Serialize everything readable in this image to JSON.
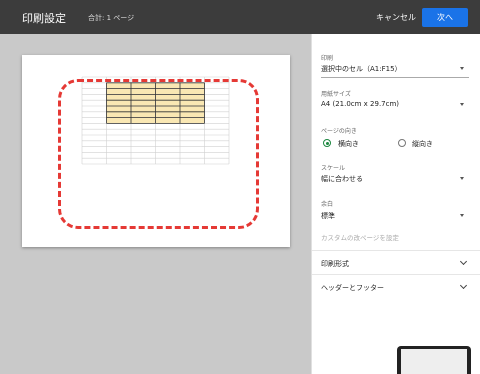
{
  "header": {
    "title": "印刷設定",
    "page_count": "合計: 1 ページ",
    "cancel_label": "キャンセル",
    "next_label": "次へ"
  },
  "colors": {
    "header_bg": "#3c3c3c",
    "accent": "#1a73e8",
    "selection_outline": "#e53935",
    "selected_cells": "#f9e7b3",
    "radio_on": "#1b873f"
  },
  "preview": {
    "sheet": {
      "rows": 15,
      "cols": 6,
      "highlight": {
        "rows": 7,
        "cols": 4
      }
    }
  },
  "settings": {
    "print_range": {
      "label": "印刷",
      "value": "選択中のセル（A1:F15）"
    },
    "paper_size": {
      "label": "用紙サイズ",
      "value": "A4 (21.0cm x 29.7cm)"
    },
    "orientation": {
      "label": "ページの向き",
      "landscape": "横向き",
      "portrait": "縦向き",
      "selected": "landscape"
    },
    "scale": {
      "label": "スケール",
      "value": "幅に合わせる"
    },
    "margins": {
      "label": "余白",
      "value": "標準"
    },
    "custom_breaks": "カスタムの改ページを設定",
    "sections": [
      {
        "label": "印刷形式"
      },
      {
        "label": "ヘッダーとフッター"
      }
    ]
  }
}
